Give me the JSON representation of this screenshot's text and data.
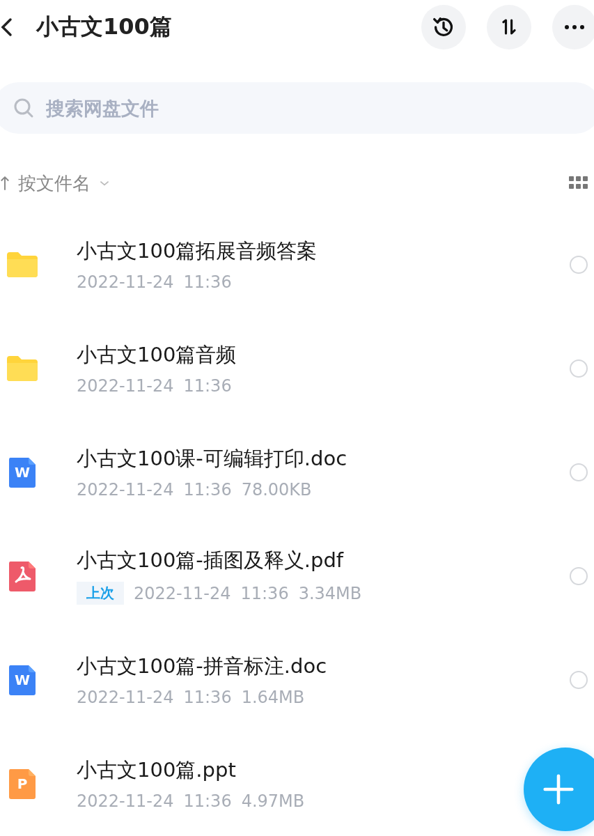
{
  "header": {
    "title": "小古文100篇"
  },
  "search": {
    "placeholder": "搜索网盘文件"
  },
  "sort": {
    "label": "按文件名"
  },
  "files": [
    {
      "kind": "folder",
      "name": "小古文100篇拓展音频答案",
      "date": "2022-11-24",
      "time": "11:36",
      "selected": false
    },
    {
      "kind": "folder",
      "name": "小古文100篇音频",
      "date": "2022-11-24",
      "time": "11:36",
      "selected": false
    },
    {
      "kind": "doc",
      "icon_letter": "W",
      "name": "小古文100课-可编辑打印.doc",
      "date": "2022-11-24",
      "time": "11:36",
      "size": "78.00KB",
      "selected": false
    },
    {
      "kind": "pdf",
      "name": "小古文100篇-插图及释义.pdf",
      "badge": "上次",
      "date": "2022-11-24",
      "time": "11:36",
      "size": "3.34MB",
      "selected": false
    },
    {
      "kind": "doc",
      "icon_letter": "W",
      "name": "小古文100篇-拼音标注.doc",
      "date": "2022-11-24",
      "time": "11:36",
      "size": "1.64MB",
      "selected": false
    },
    {
      "kind": "ppt",
      "icon_letter": "P",
      "name": "小古文100篇.ppt",
      "date": "2022-11-24",
      "time": "11:36",
      "size": "4.97MB"
    }
  ]
}
